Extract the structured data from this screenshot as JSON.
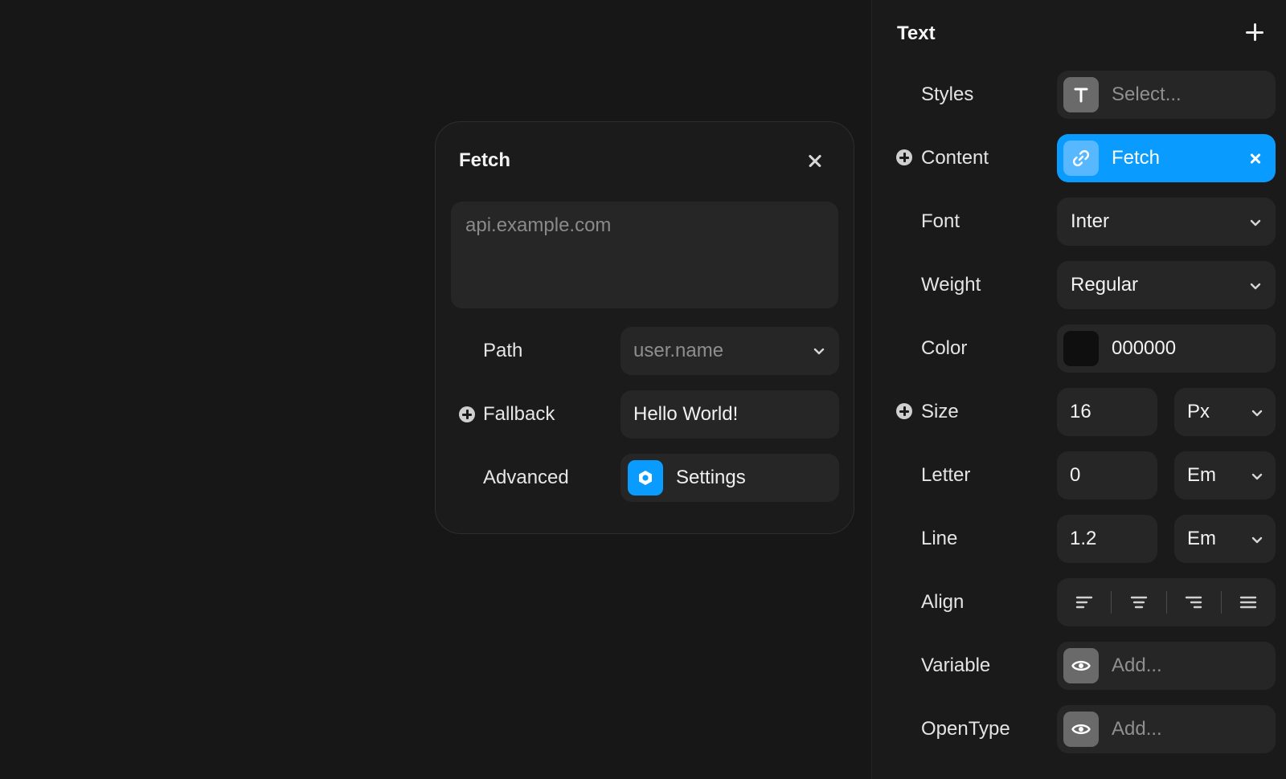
{
  "popover": {
    "title": "Fetch",
    "url_placeholder": "api.example.com",
    "path": {
      "label": "Path",
      "value": "user.name"
    },
    "fallback": {
      "label": "Fallback",
      "value": "Hello World!"
    },
    "advanced": {
      "label": "Advanced",
      "value": "Settings"
    }
  },
  "panel": {
    "title": "Text",
    "styles": {
      "label": "Styles",
      "placeholder": "Select..."
    },
    "content": {
      "label": "Content",
      "value": "Fetch"
    },
    "font": {
      "label": "Font",
      "value": "Inter"
    },
    "weight": {
      "label": "Weight",
      "value": "Regular"
    },
    "color": {
      "label": "Color",
      "value": "000000",
      "swatch": "#0f0f0f"
    },
    "size": {
      "label": "Size",
      "value": "16",
      "unit": "Px"
    },
    "letter": {
      "label": "Letter",
      "value": "0",
      "unit": "Em"
    },
    "line": {
      "label": "Line",
      "value": "1.2",
      "unit": "Em"
    },
    "align": {
      "label": "Align",
      "options": [
        "left",
        "center",
        "right",
        "justify"
      ]
    },
    "variable": {
      "label": "Variable",
      "placeholder": "Add..."
    },
    "opentype": {
      "label": "OpenType",
      "placeholder": "Add..."
    }
  },
  "colors": {
    "accent": "#0a9bff",
    "background": "#171717",
    "panel": "#1a1a1a",
    "control": "#262626"
  },
  "icons": {
    "close": "close-icon",
    "add": "plus-icon",
    "chevron": "chevron-down-icon",
    "settings": "settings-icon",
    "link": "link-icon",
    "text_style": "text-t-icon",
    "eye": "eye-icon",
    "plus_circle": "plus-circle-icon"
  }
}
